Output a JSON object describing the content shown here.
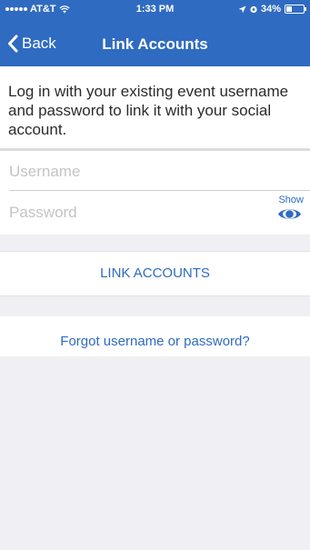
{
  "status_bar": {
    "carrier": "AT&T",
    "time": "1:33 PM",
    "battery": "34%"
  },
  "nav": {
    "back_label": "Back",
    "title": "Link Accounts"
  },
  "intro": {
    "text": "Log in with your existing event username and password to link it with your social account."
  },
  "form": {
    "username_placeholder": "Username",
    "username_value": "",
    "password_placeholder": "Password",
    "password_value": "",
    "show_label": "Show"
  },
  "actions": {
    "link_accounts_label": "LINK ACCOUNTS",
    "forgot_label": "Forgot username or password?"
  },
  "icons": {
    "back": "chevron-left-icon",
    "wifi": "wifi-icon",
    "location": "location-arrow-icon",
    "alarm": "alarm-icon",
    "battery": "battery-icon",
    "show_password": "eye-icon"
  },
  "colors": {
    "brand": "#2f6bc0",
    "background": "#efeff4",
    "text": "#2b2b2b",
    "placeholder": "#c4c4c8"
  }
}
